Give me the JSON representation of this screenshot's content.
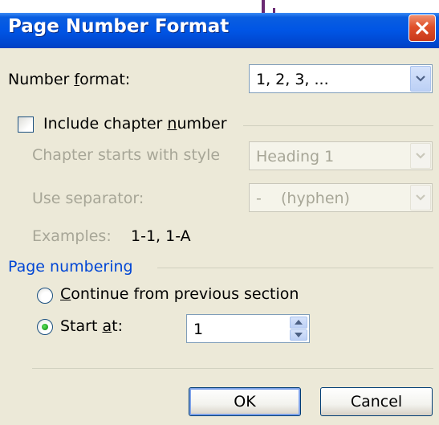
{
  "dialog": {
    "title": "Page Number Format",
    "number_format": {
      "label_before": "Number ",
      "label_accel": "f",
      "label_after": "ormat:",
      "value": "1, 2, 3, ..."
    },
    "include_chapter": {
      "label_before": "Include chapter ",
      "label_accel": "n",
      "label_after": "umber",
      "checked": false
    },
    "chapter_style": {
      "label": "Chapter starts with style",
      "value": "Heading 1"
    },
    "separator": {
      "label": "Use separator:",
      "value": "-    (hyphen)"
    },
    "examples": {
      "label": "Examples:",
      "value": "1-1, 1-A"
    },
    "page_numbering": {
      "title": "Page numbering",
      "continue": {
        "label_accel": "C",
        "label_after": "ontinue from previous section",
        "selected": false
      },
      "start_at": {
        "label_before": "Start ",
        "label_accel": "a",
        "label_after": "t:",
        "selected": true,
        "value": "1"
      }
    },
    "buttons": {
      "ok": "OK",
      "cancel": "Cancel"
    }
  }
}
